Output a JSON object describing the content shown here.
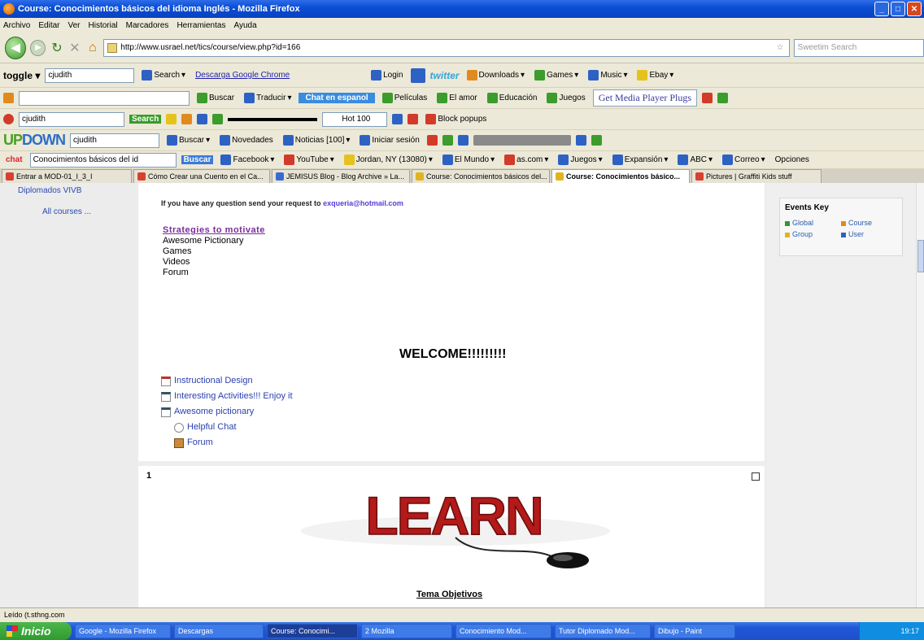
{
  "window": {
    "title": "Course: Conocimientos básicos del idioma Inglés - Mozilla Firefox"
  },
  "menu": [
    "Archivo",
    "Editar",
    "Ver",
    "Historial",
    "Marcadores",
    "Herramientas",
    "Ayuda"
  ],
  "nav": {
    "url": "http://www.usrael.net/tics/course/view.php?id=166",
    "search_placeholder": "Sweetim Search"
  },
  "toolbar1": {
    "field": "cjudith",
    "search": "Search",
    "descarga": "Descarga Google Chrome",
    "login": "Login",
    "twitter": "twitter",
    "downloads": "Downloads",
    "games": "Games",
    "music": "Music",
    "ebay": "Ebay"
  },
  "toolbar2": {
    "buscar": "Buscar",
    "traducir": "Traducir",
    "chat": "Chat en espanol",
    "peliculas": "Películas",
    "amor": "El amor",
    "educacion": "Educación",
    "juegos": "Juegos",
    "media": "Get Media Player Plugs"
  },
  "toolbar3": {
    "field": "cjudith",
    "search": "Search",
    "block": "Block popups",
    "hot": "Hot 100"
  },
  "toolbar4": {
    "logo_a": "UP",
    "logo_b": "DOWN",
    "field": "cjudith",
    "buscar": "Buscar",
    "novedades": "Novedades",
    "noticias": "Noticias [100]",
    "sesion": "Iniciar sesión"
  },
  "toolbar5": {
    "chat": "chat",
    "field": "Conocimientos básicos del id",
    "buscar": "Buscar",
    "facebook": "Facebook",
    "youtube": "YouTube",
    "jordan": "Jordan, NY (13080)",
    "elmundo": "El Mundo",
    "ascom": "as.com",
    "juegos": "Juegos",
    "expansion": "Expansión",
    "abc": "ABC",
    "correo": "Correo",
    "opciones": "Opciones"
  },
  "tabs": [
    "Entrar a MOD-01_I_3_I",
    "Cómo Crear una Cuento en el Ca...",
    "JEMISUS Blog - Blog Archive » La...",
    "Course: Conocimientos básicos del...",
    "Course: Conocimientos básico...",
    "Pictures | Graffiti Kids stuff"
  ],
  "left": {
    "diplomados": "Diplomados VIVB",
    "all_courses": "All courses ..."
  },
  "center": {
    "contact_prefix": "If you have any question send your request to",
    "contact_email": "exqueria@hotmail.com",
    "strategies_link": "Strategies to motivate",
    "strategies": [
      "Awesome Pictionary",
      "Games",
      "Videos",
      "Forum"
    ],
    "welcome": "WELCOME!!!!!!!!!",
    "activities": [
      {
        "label": "Instructional Design",
        "icon": "document-icon"
      },
      {
        "label": "Interesting Activities!!! Enjoy it",
        "icon": "quiz-icon"
      },
      {
        "label": "Awesome pictionary",
        "icon": "quiz-icon"
      },
      {
        "label": "Helpful Chat",
        "icon": "chat-icon"
      },
      {
        "label": "Forum",
        "icon": "forum-icon"
      }
    ],
    "section_number": "1",
    "learn_text": "LEARN",
    "tema": "Tema Objetivos"
  },
  "events_key": {
    "title": "Events Key",
    "items": [
      "Global",
      "Course",
      "Group",
      "User"
    ],
    "colors": [
      "#2c9c2c",
      "#e08a1e",
      "#e0b41e",
      "#3060c0"
    ]
  },
  "status": "Leído (t.sthng.com",
  "taskbar": {
    "start": "Inicio",
    "items": [
      "Google - Mozilla Firefox",
      "Descargas",
      "Course: Conocimi...",
      "2 Mozilla",
      "Conocimiento Mod...",
      "Tutor Diplomado Mod...",
      "Dibujo - Paint"
    ],
    "clock": "19:17"
  }
}
